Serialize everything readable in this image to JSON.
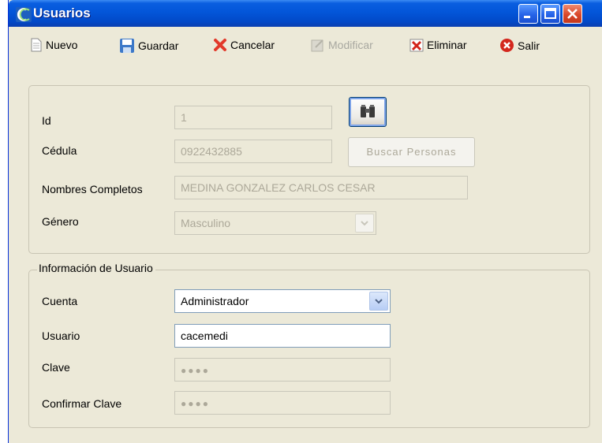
{
  "window": {
    "title": "Usuarios"
  },
  "toolbar": {
    "nuevo": "Nuevo",
    "guardar": "Guardar",
    "cancelar": "Cancelar",
    "modificar": "Modificar",
    "eliminar": "Eliminar",
    "salir": "Salir"
  },
  "persona": {
    "id_label": "Id",
    "id_value": "1",
    "cedula_label": "Cédula",
    "cedula_value": "0922432885",
    "buscar_label": "Buscar Personas",
    "nombres_label": "Nombres Completos",
    "nombres_value": "MEDINA GONZALEZ  CARLOS CESAR",
    "genero_label": "Género",
    "genero_value": "Masculino"
  },
  "usuario": {
    "legend": "Información de Usuario",
    "cuenta_label": "Cuenta",
    "cuenta_value": "Administrador",
    "usuario_label": "Usuario",
    "usuario_value": "cacemedi",
    "clave_label": "Clave",
    "clave_value": "●●●●",
    "confirmar_label": "Confirmar Clave",
    "confirmar_value": "●●●●"
  },
  "colors": {
    "titlebar": "#0356D9",
    "window_bg": "#ECE9D8",
    "field_border": "#7F9DB9",
    "disabled_text": "#ACA899"
  },
  "icons": [
    "app-icon",
    "minimize-icon",
    "maximize-icon",
    "close-icon",
    "new-document-icon",
    "save-disk-icon",
    "cancel-x-icon",
    "edit-icon",
    "delete-icon",
    "exit-icon",
    "binoculars-icon",
    "chevron-down-icon"
  ]
}
